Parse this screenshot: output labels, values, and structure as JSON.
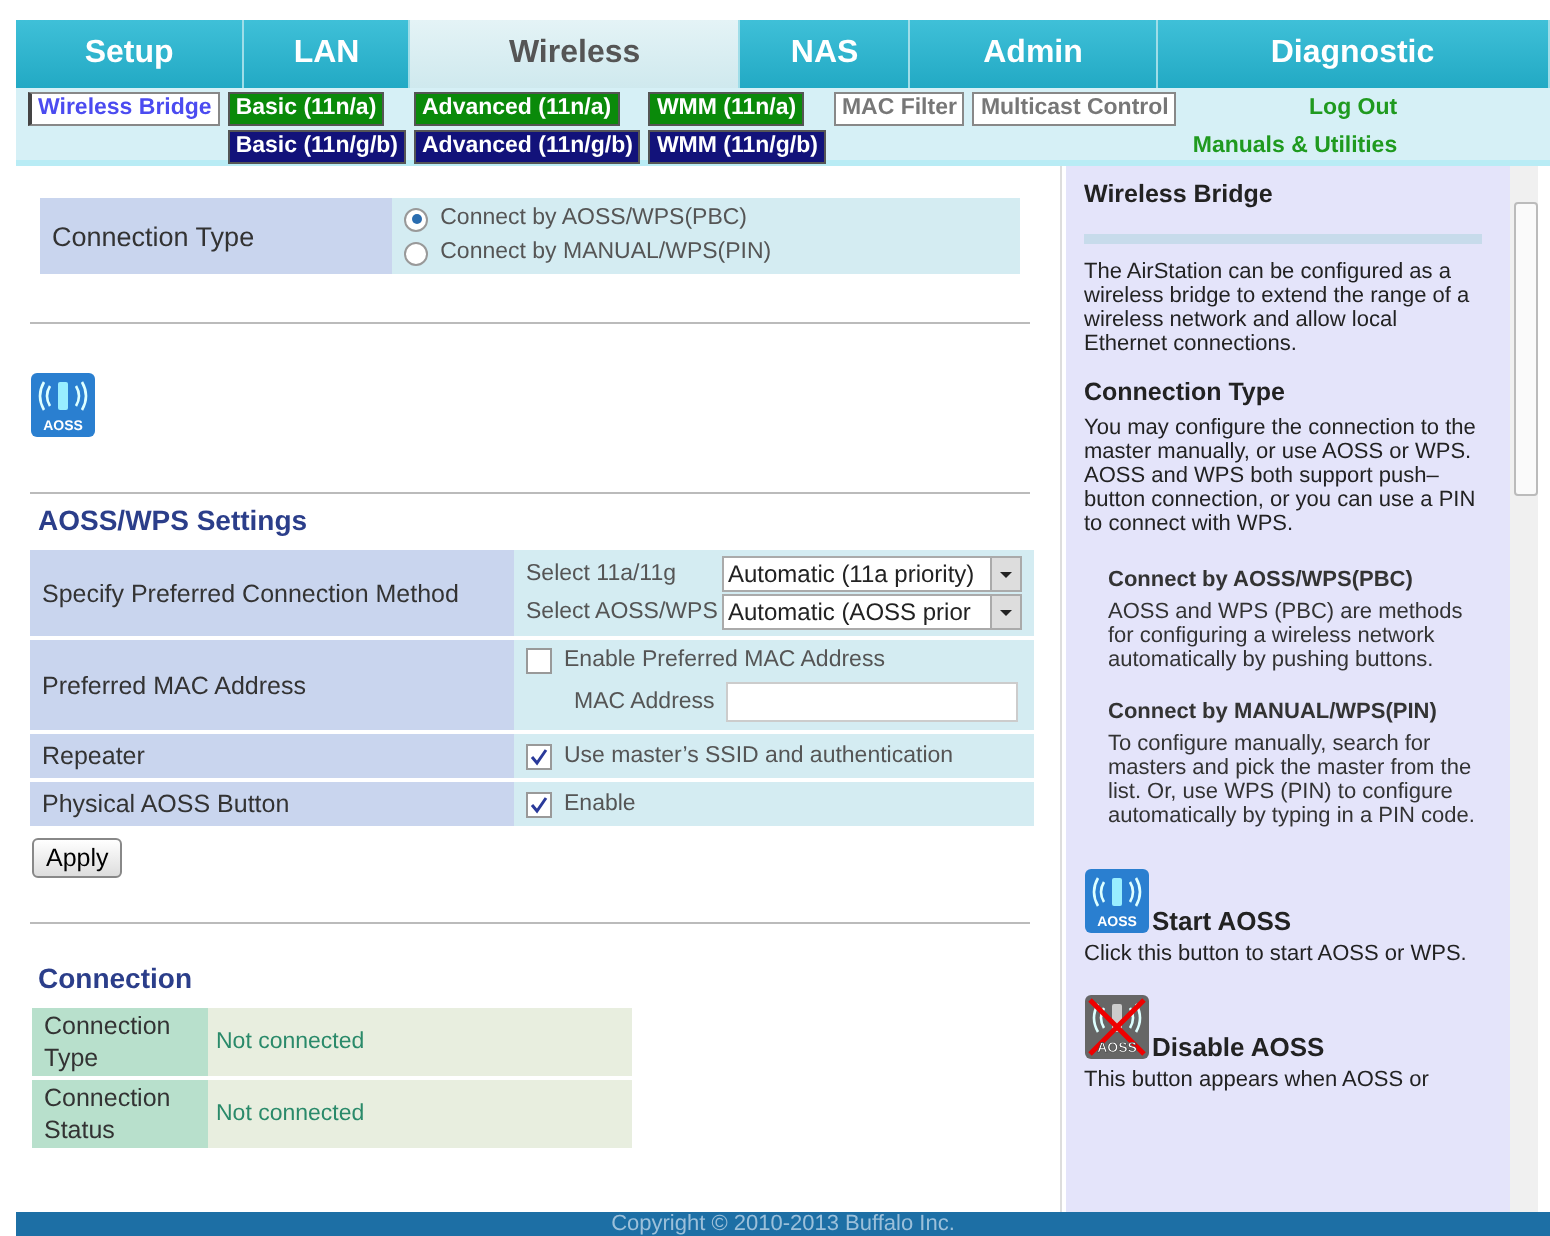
{
  "tabs": [
    {
      "label": "Setup",
      "selected": false
    },
    {
      "label": "LAN",
      "selected": false
    },
    {
      "label": "Wireless",
      "selected": true
    },
    {
      "label": "NAS",
      "selected": false
    },
    {
      "label": "Admin",
      "selected": false
    },
    {
      "label": "Diagnostic",
      "selected": false
    }
  ],
  "subnav": [
    [
      {
        "label": "Wireless Bridge",
        "kind": "current"
      }
    ],
    [
      {
        "label": "Basic (11n/a)",
        "kind": "green"
      },
      {
        "label": "Basic (11n/g/b)",
        "kind": "blue"
      }
    ],
    [
      {
        "label": "Advanced (11n/a)",
        "kind": "green"
      },
      {
        "label": "Advanced (11n/g/b)",
        "kind": "blue"
      }
    ],
    [
      {
        "label": "WMM (11n/a)",
        "kind": "green"
      },
      {
        "label": "WMM (11n/g/b)",
        "kind": "blue"
      }
    ],
    [
      {
        "label": "MAC Filter",
        "kind": "gray"
      }
    ],
    [
      {
        "label": "Multicast Control",
        "kind": "gray"
      }
    ],
    [
      {
        "label": "Log Out",
        "kind": "link"
      },
      {
        "label": "Manuals & Utilities",
        "kind": "link"
      }
    ]
  ],
  "connection_type": {
    "label": "Connection Type",
    "options": [
      {
        "label": "Connect by AOSS/WPS(PBC)",
        "selected": true
      },
      {
        "label": "Connect by MANUAL/WPS(PIN)",
        "selected": false
      }
    ]
  },
  "aoss_icon_text": "AOSS",
  "aoss_settings": {
    "title": "AOSS/WPS Settings",
    "method": {
      "label": "Specify Preferred Connection Method",
      "selects": [
        {
          "label": "Select 11a/11g",
          "value": "Automatic (11a priority)"
        },
        {
          "label": "Select AOSS/WPS",
          "value": "Automatic (AOSS prior"
        }
      ]
    },
    "mac": {
      "label": "Preferred MAC Address",
      "checkbox": {
        "label": "Enable Preferred MAC Address",
        "checked": false
      },
      "field_label": "MAC Address"
    },
    "repeater": {
      "label": "Repeater",
      "checkbox": {
        "label": "Use master’s SSID and authentication",
        "checked": true
      }
    },
    "physical": {
      "label": "Physical AOSS Button",
      "checkbox": {
        "label": "Enable",
        "checked": true
      }
    },
    "apply": "Apply"
  },
  "connection": {
    "title": "Connection",
    "rows": [
      {
        "label": "Connection Type",
        "value": "Not connected"
      },
      {
        "label": "Connection Status",
        "value": "Not connected"
      }
    ]
  },
  "help": {
    "title": "Wireless Bridge",
    "intro": "The AirStation can be configured as a wireless bridge to extend the range of a wireless network and allow local Ethernet connections.",
    "section": "Connection Type",
    "section_text": "You may configure the connection to the master manually, or use AOSS or WPS. AOSS and WPS both support push–button connection, or you can use a PIN to connect with WPS.",
    "items": [
      {
        "title": "Connect by AOSS/WPS(PBC)",
        "text": "AOSS and WPS (PBC) are methods for configuring a wireless network automatically by pushing buttons."
      },
      {
        "title": "Connect by MANUAL/WPS(PIN)",
        "text": "To configure manually, search for masters and pick the master from the list. Or, use WPS (PIN) to configure automatically by typing in a PIN code."
      }
    ],
    "buttons": [
      {
        "title": "Start AOSS",
        "icon_text": "AOSS",
        "disabled": false,
        "text": "Click this button to start AOSS or WPS."
      },
      {
        "title": "Disable AOSS",
        "icon_text": "AOSS",
        "disabled": true,
        "text": "This button appears when AOSS or"
      }
    ]
  },
  "footer": "Copyright © 2010-2013 Buffalo Inc."
}
